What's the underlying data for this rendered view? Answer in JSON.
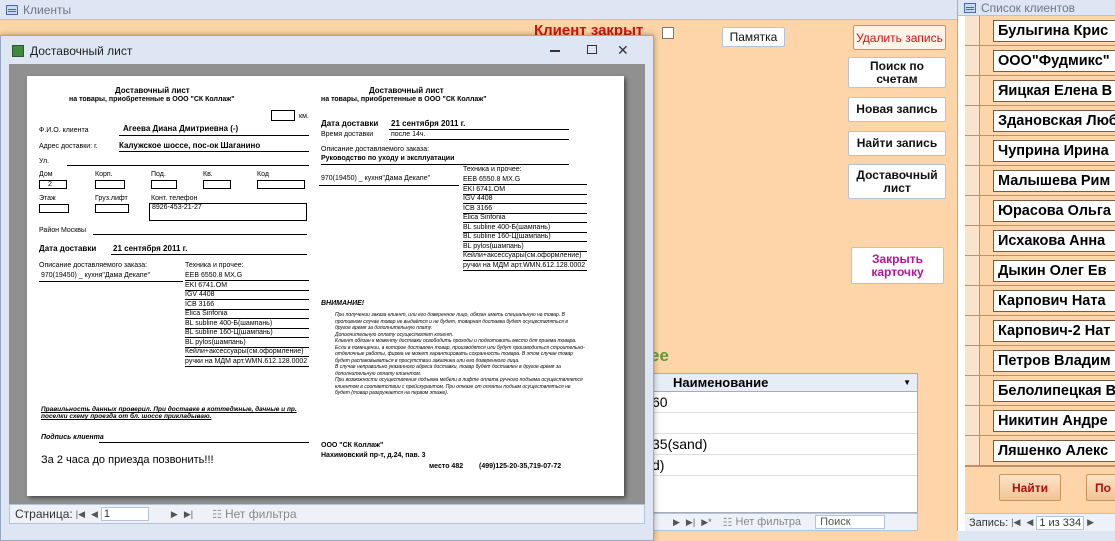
{
  "clients_window": {
    "title": "Клиенты",
    "client_closed": "Клиент закрыт"
  },
  "buttons": {
    "memo": "Памятка",
    "delete": "Удалить запись",
    "search_accounts": "Поиск по счетам",
    "new_record": "Новая запись",
    "find_record": "Найти запись",
    "delivery_sheet": "Доставочный лист",
    "close_card": "Закрыть карточку"
  },
  "subform": {
    "suffix_label": "ее",
    "column_header": "Наименование",
    "rows": [
      "60",
      "",
      "35(sand)",
      "d)"
    ],
    "nav": {
      "filter": "Нет фильтра",
      "search": "Поиск"
    }
  },
  "client_list": {
    "title": "Список клиентов",
    "items": [
      "Булыгина Крис",
      "ООО\"Фудмикс\"",
      "Яицкая Елена В",
      "Здановская Люб",
      "Чуприна Ирина",
      "Малышева Рим",
      "Юрасова Ольга",
      "Исхакова Анна",
      "Дыкин Олег Ев",
      "Карпович Ната",
      "Карпович-2 Нат",
      "Петров Владим",
      "Белолипецкая В",
      "Никитин Андре",
      "Ляшенко Алекс"
    ],
    "find_btn": "Найти",
    "next_btn": "По",
    "nav": {
      "label": "Запись:",
      "pos": "1 из 334"
    }
  },
  "report_window": {
    "title": "Доставочный лист",
    "nav": {
      "label": "Страница:",
      "page": "1",
      "filter": "Нет фильтра"
    }
  },
  "report": {
    "heading": "Доставочный лист",
    "subheading": "на товары, приобретенные в ООО \"СК Коллаж\"",
    "km": "км.",
    "fio_label": "Ф.И.О. клиента",
    "fio": "Агеева Диана Дмитриевна (-)",
    "address_label": "Адрес доставки: г.",
    "address": "Калужское шоссе, пос-ок Шаганино",
    "street_label": "Ул.",
    "house_label": "Дом",
    "house": "2",
    "korp_label": "Корп.",
    "entr_label": "Под.",
    "flat_label": "Кв.",
    "code_label": "Код",
    "floor_label": "Этаж",
    "lift_label": "Груз.лифт",
    "phone_label": "Конт. телефон",
    "phone": "8926-453-21-27",
    "district_label": "Район Москвы",
    "date_label": "Дата доставки",
    "date": "21 сентября 2011 г.",
    "order_label": "Описание доставляемого заказа:",
    "order": "970(19450) _ кухня\"Дама Декапе\"",
    "tech_label": "Техника и прочее:",
    "tech": [
      "EEB 6550.8 MX.G",
      "EKI 6741.OM",
      "IGV 4408",
      "ICB 3166",
      "Elica Sinfonia",
      "BL subline 400-Б(шампань)",
      "BL subline 160-Ц(шампань)",
      "BL pylos(шампань)",
      "Кейли+аксессуары(см.оформление)",
      "ручки на МДМ  арт.WMN.612.128.0002"
    ],
    "check_note": "Правильность данных проверил. При доставке в коттеджные, дачные и пр. поселки схему проезда от бл. шоссе прикладываю.",
    "signature_label": "Подпись клиента",
    "call_note": "За 2 часа до приезда позвонить!!!",
    "time_label": "Время доставки",
    "time": "после 14ч.",
    "resp_label": "Описание доставляемого заказа:",
    "resp": "Руководство по уходу и эксплуатации",
    "attention": "ВНИМАНИЕ!",
    "rules": [
      "При получении заказа клиент, или его доверенное лицо, обязан иметь специальную на товар. В противном случае товар не выдаётся и не будет, товарная доставка будет осуществляться в другое время за дополнительную плату.",
      "Дополнительную оплату осуществляет клиент.",
      "Клиент обязан к моменту доставки освободить проходы и подготовить место для приема товара.",
      "Если в помещении, в которое доставлен товар, производятся или будут производиться строительно-отделочные работы, фирма не может гарантировать сохранность товара. В этом случае товар будет распаковываться в присутствии заказчика или его доверенного лица.",
      "В случае неправильно указанного адреса доставки, товар будет доставлен в другое время за дополнительную оплату клиентом.",
      "При возможности осуществления подъема мебели в лифте оплата ручного подъема осуществляется клиентом в соответствии с прейскурантом. При отказе от оплаты подъем осуществляться не будет (товар разгружается на первом этаже)."
    ],
    "company": "ООО \"СК Коллаж\"",
    "company_addr": "Нахимовский пр-т, д.24, пав. 3",
    "company_place": "место 482",
    "company_phone": "(499)125-20-35,719-07-72"
  }
}
